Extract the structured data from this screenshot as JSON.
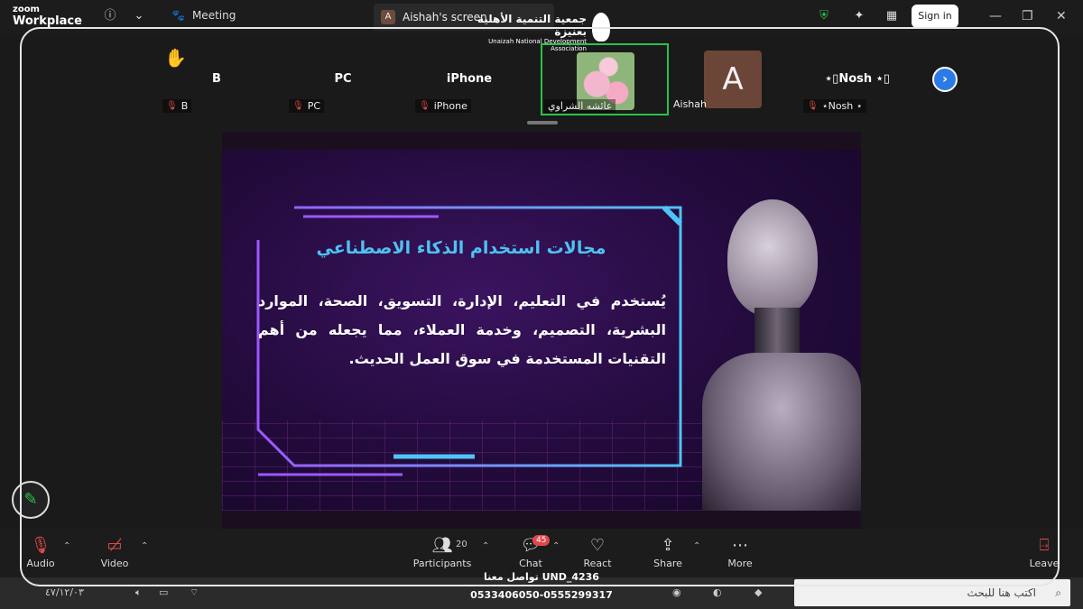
{
  "titlebar": {
    "brand_top": "zoom",
    "brand_bottom": "Workplace",
    "meeting_label": "Meeting",
    "screen_tab_label": "Aishah's screen",
    "screen_tab_avatar": "A",
    "sign_in": "Sign in"
  },
  "logo": {
    "arabic": "جمعية التنمية الأهلية بعنيزة",
    "english": "Unaizah National Development Association"
  },
  "participants": [
    {
      "name": "B",
      "label": "B",
      "muted": true
    },
    {
      "name": "PC",
      "label": "PC",
      "muted": true
    },
    {
      "name": "iPhone",
      "label": "iPhone",
      "muted": true
    },
    {
      "name": "",
      "label": "عائشه الشراوي",
      "muted": false,
      "active": true,
      "video": "roses"
    },
    {
      "name": "",
      "label": "Aishah",
      "muted": false,
      "avatar": "A"
    },
    {
      "name": "⋆▯Nosh ⋆▯",
      "label": "⋆Nosh ⋆",
      "muted": true
    }
  ],
  "slide": {
    "title": "مجالات استخدام الذكاء الاصطناعي",
    "body": "يُستخدم في التعليم، الإدارة، التسويق، الصحة، الموارد البشرية، التصميم، وخدمة العملاء، مما يجعله من أهم التقنيات المستخدمة في سوق العمل الحديث."
  },
  "toolbar": {
    "audio": "Audio",
    "video": "Video",
    "participants": "Participants",
    "participants_count": "20",
    "chat": "Chat",
    "chat_badge": "45",
    "react": "React",
    "share": "Share",
    "more": "More",
    "leave": "Leave"
  },
  "taskbar": {
    "date": "٤٧/١٢/٠٣",
    "search_placeholder": "اكتب هنا للبحث"
  },
  "contact": {
    "line1": "تواصل معنا UND_4236",
    "line2": "0533406050-0555299317"
  },
  "colors": {
    "active_tile": "#2bc24a",
    "slide_title": "#4dc3f0",
    "mute": "#e04a4a",
    "next_button": "#2c7be5"
  }
}
